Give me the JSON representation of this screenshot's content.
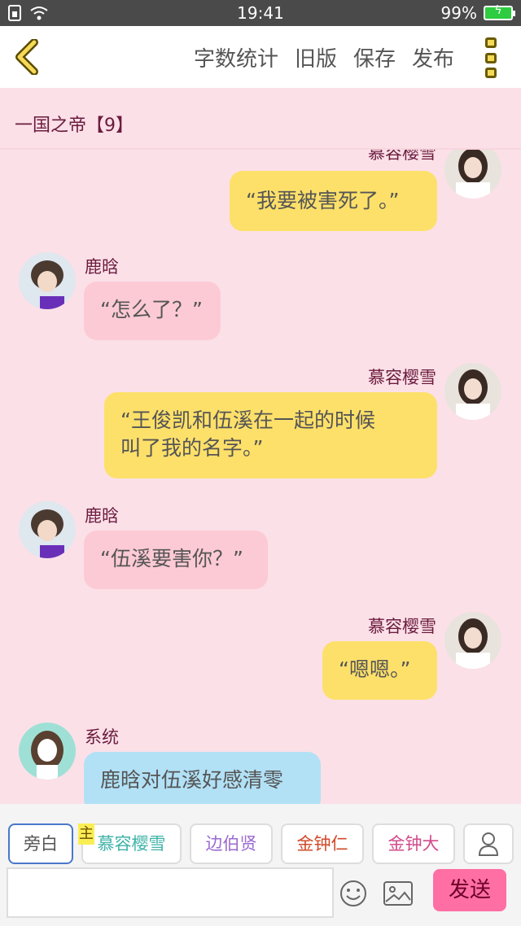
{
  "status_bar": {
    "time": "19:41",
    "battery_percent": "99%",
    "battery_level": 0.99,
    "icons": [
      "sim-icon",
      "wifi-icon",
      "battery-icon"
    ]
  },
  "toolbar": {
    "back_icon": "chevron-left-icon",
    "actions": [
      "字数统计",
      "旧版",
      "保存",
      "发布"
    ],
    "menu_icon": "vertical-dots-icon"
  },
  "chapter": {
    "title": "一国之帝【9】"
  },
  "messages": [
    {
      "speaker": "慕容樱雪",
      "side": "right",
      "text": "“我要被害死了。”",
      "bubble_color": "#fde06a"
    },
    {
      "speaker": "鹿晗",
      "side": "left",
      "text": "“怎么了？”",
      "bubble_color": "#fccad5"
    },
    {
      "speaker": "慕容樱雪",
      "side": "right",
      "text": "“王俊凯和伍溪在一起的时候",
      "text2": "叫了我的名字。”",
      "bubble_color": "#fde06a"
    },
    {
      "speaker": "鹿晗",
      "side": "left",
      "text": "“伍溪要害你？”",
      "bubble_color": "#fccad5"
    },
    {
      "speaker": "慕容樱雪",
      "side": "right",
      "text": "“嗯嗯。”",
      "bubble_color": "#fde06a"
    },
    {
      "speaker": "系统",
      "side": "left",
      "text": "鹿晗对伍溪好感清零",
      "bubble_color": "#b2e1f6"
    }
  ],
  "roles": [
    {
      "label": "旁白",
      "color": "#555555",
      "active": true
    },
    {
      "label": "慕容樱雪",
      "color": "#3fb3a8",
      "badge": "主"
    },
    {
      "label": "边伯贤",
      "color": "#9b6bd0"
    },
    {
      "label": "金钟仁",
      "color": "#d2492a"
    },
    {
      "label": "金钟大",
      "color": "#d24a8a"
    }
  ],
  "add_role_icon": "person-icon",
  "input": {
    "value": "",
    "emoji_icon": "emoji-icon",
    "image_icon": "image-icon",
    "send_label": "发送"
  }
}
